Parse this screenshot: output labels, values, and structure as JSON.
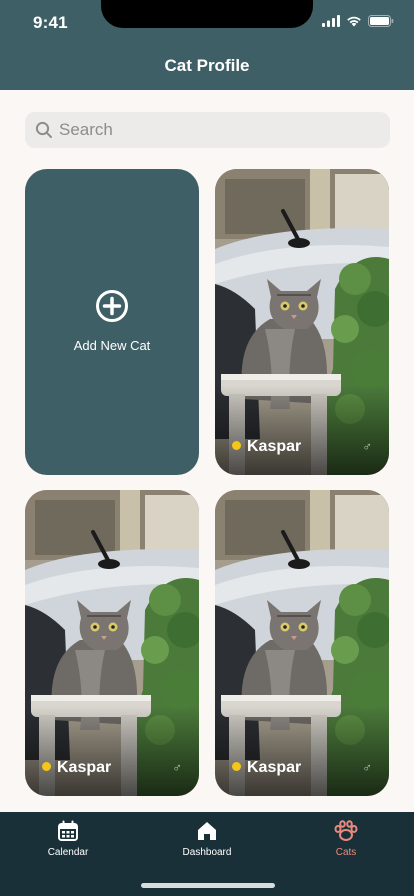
{
  "status": {
    "time": "9:41"
  },
  "header": {
    "title": "Cat Profile"
  },
  "search": {
    "placeholder": "Search"
  },
  "add_card": {
    "label": "Add New Cat"
  },
  "cats": [
    {
      "name": "Kaspar",
      "gender_symbol": "♂",
      "status_color": "#f5c518"
    },
    {
      "name": "Kaspar",
      "gender_symbol": "♂",
      "status_color": "#f5c518"
    },
    {
      "name": "Kaspar",
      "gender_symbol": "♂",
      "status_color": "#f5c518"
    }
  ],
  "tabbar": {
    "items": [
      {
        "label": "Calendar",
        "icon": "calendar-icon"
      },
      {
        "label": "Dashboard",
        "icon": "home-icon"
      },
      {
        "label": "Cats",
        "icon": "paw-icon",
        "active": true
      }
    ]
  },
  "colors": {
    "primary": "#3f5f66",
    "tabbar": "#1a3038",
    "accent": "#e98a7e",
    "status_dot": "#f5c518"
  }
}
